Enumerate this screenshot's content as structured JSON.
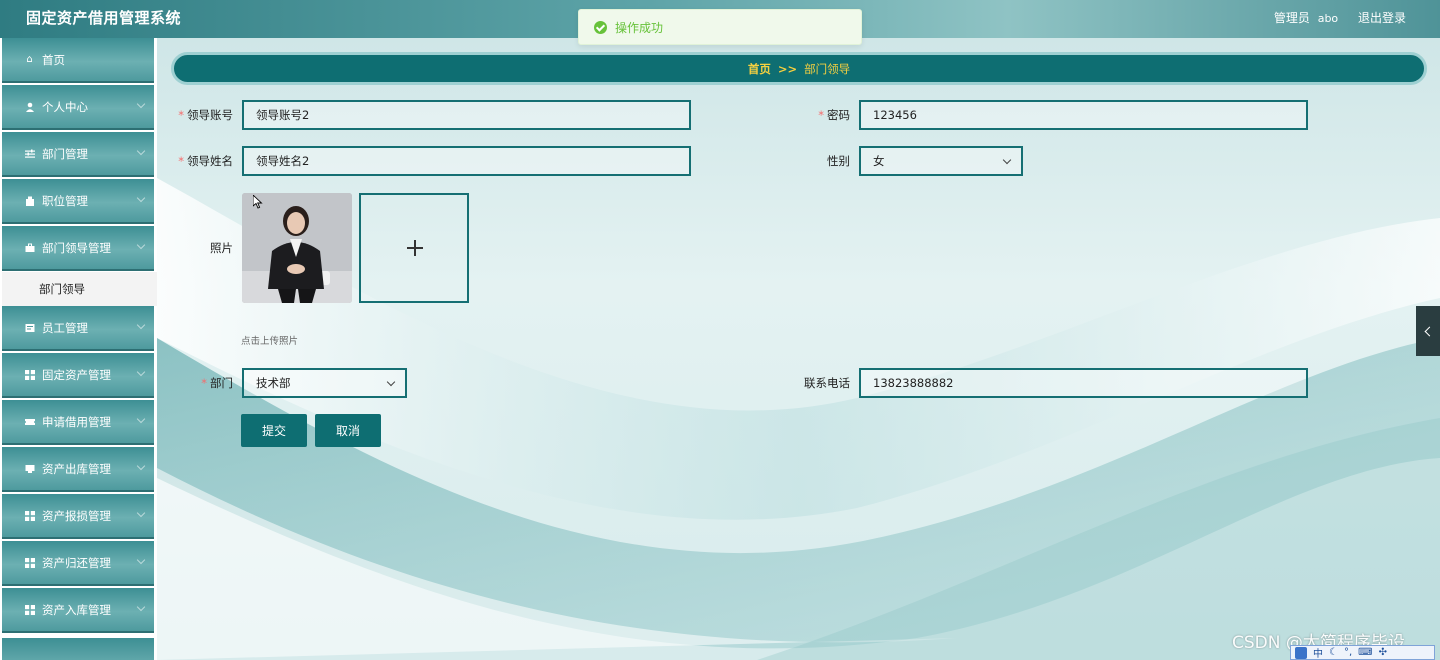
{
  "header": {
    "app_title": "固定资产借用管理系统",
    "role": "管理员",
    "username": "abo",
    "logout_label": "退出登录"
  },
  "toast": {
    "message": "操作成功",
    "color": "#67c23a"
  },
  "sidebar": {
    "items": [
      {
        "label": "首页",
        "icon": "home-icon"
      },
      {
        "label": "个人中心",
        "icon": "user-icon"
      },
      {
        "label": "部门管理",
        "icon": "sliders-icon"
      },
      {
        "label": "职位管理",
        "icon": "building-icon"
      },
      {
        "label": "部门领导管理",
        "icon": "briefcase-icon"
      },
      {
        "label": "员工管理",
        "icon": "id-card-icon"
      },
      {
        "label": "固定资产管理",
        "icon": "grid-icon"
      },
      {
        "label": "申请借用管理",
        "icon": "ticket-icon"
      },
      {
        "label": "资产出库管理",
        "icon": "box-icon"
      },
      {
        "label": "资产报损管理",
        "icon": "grid-icon"
      },
      {
        "label": "资产归还管理",
        "icon": "grid-icon"
      },
      {
        "label": "资产入库管理",
        "icon": "grid-icon"
      }
    ],
    "active_submenu": "部门领导"
  },
  "breadcrumb": {
    "home": "首页",
    "separator": ">>",
    "current": "部门领导"
  },
  "form": {
    "account_label": "领导账号",
    "account_value": "领导账号2",
    "password_label": "密码",
    "password_value": "123456",
    "name_label": "领导姓名",
    "name_value": "领导姓名2",
    "gender_label": "性别",
    "gender_value": "女",
    "photo_label": "照片",
    "upload_hint": "点击上传照片",
    "department_label": "部门",
    "department_value": "技术部",
    "phone_label": "联系电话",
    "phone_value": "13823888882",
    "submit_label": "提交",
    "cancel_label": "取消"
  },
  "watermark": "CSDN @太简程序毕设",
  "ime": {
    "label": "中"
  },
  "colors": {
    "primary": "#0e6e72",
    "breadcrumb_text": "#f5d040",
    "required": "#f56c6c"
  }
}
